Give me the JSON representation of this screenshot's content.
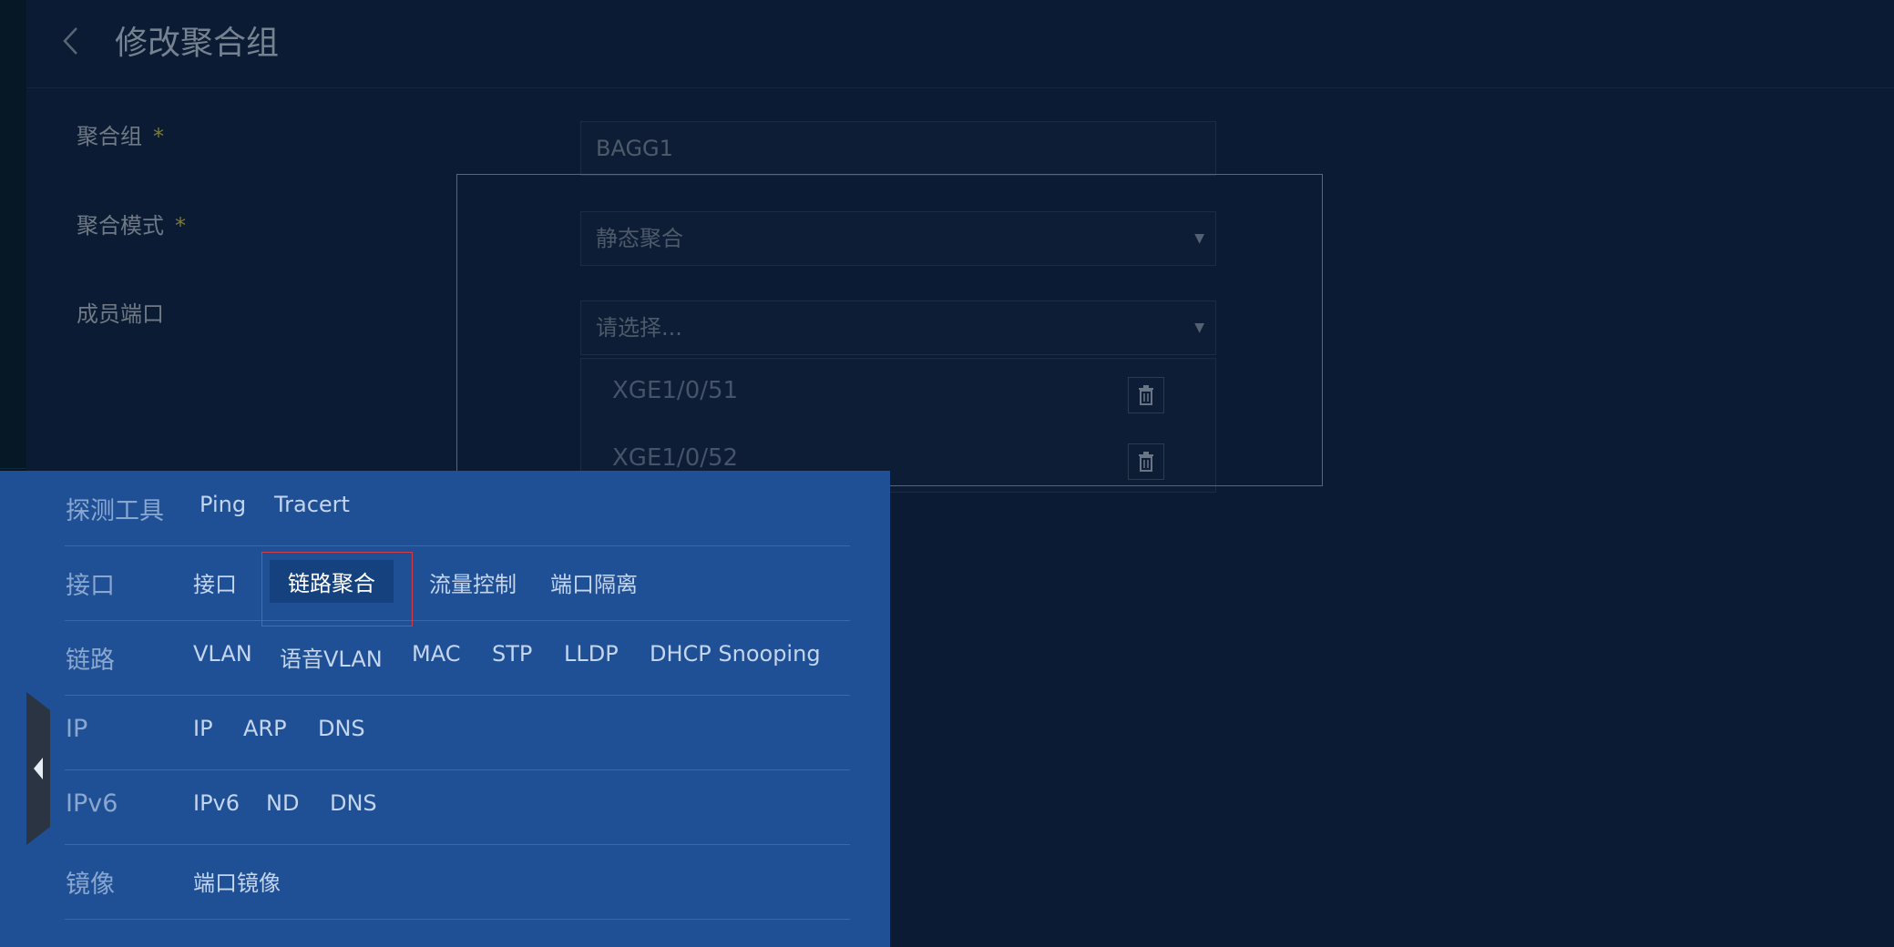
{
  "page": {
    "title": "修改聚合组"
  },
  "form": {
    "group_label": "聚合组",
    "group_required": "*",
    "group_value": "BAGG1",
    "mode_label": "聚合模式",
    "mode_required": "*",
    "mode_value": "静态聚合",
    "members_label": "成员端口",
    "members_placeholder": "请选择...",
    "members": [
      "XGE1/0/51",
      "XGE1/0/52"
    ]
  },
  "menu": {
    "rows": [
      {
        "category": "探测工具",
        "items": [
          "Ping",
          "Tracert"
        ]
      },
      {
        "category": "接口",
        "items": [
          "接口",
          "链路聚合",
          "流量控制",
          "端口隔离"
        ]
      },
      {
        "category": "链路",
        "items": [
          "VLAN",
          "语音VLAN",
          "MAC",
          "STP",
          "LLDP",
          "DHCP Snooping"
        ]
      },
      {
        "category": "IP",
        "items": [
          "IP",
          "ARP",
          "DNS"
        ]
      },
      {
        "category": "IPv6",
        "items": [
          "IPv6",
          "ND",
          "DNS"
        ]
      },
      {
        "category": "镜像",
        "items": [
          "端口镜像"
        ]
      }
    ],
    "active_item": "链路聚合"
  },
  "icons": {
    "back": "chevron-left-icon",
    "trash": "trash-icon",
    "collapse": "triangle-left-icon",
    "dropdown": "caret-down-icon"
  },
  "colors": {
    "background": "#0b1b33",
    "menu_panel": "#1f4f95",
    "active_item": "#15427f",
    "highlight_border": "#c43a43"
  }
}
